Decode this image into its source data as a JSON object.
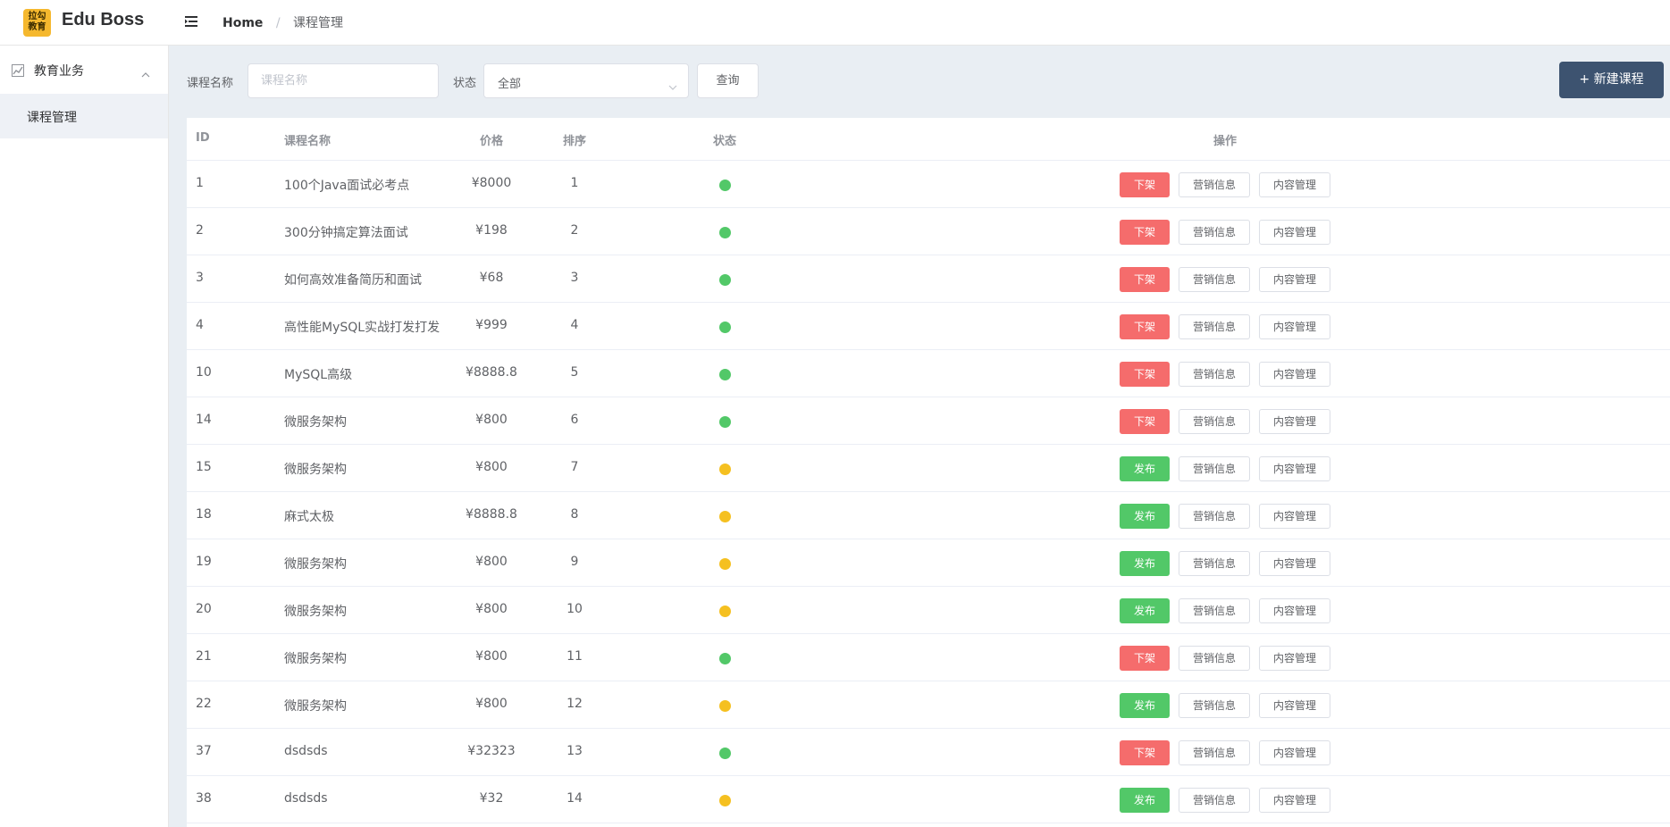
{
  "header": {
    "logo_text_top": "拉勾",
    "logo_text_bottom": "教育",
    "app_title": "Edu Boss",
    "breadcrumb_home": "Home",
    "breadcrumb_sep": "/",
    "breadcrumb_current": "课程管理"
  },
  "sidebar": {
    "group_label": "教育业务",
    "items": [
      {
        "label": "课程管理"
      }
    ]
  },
  "filters": {
    "name_label": "课程名称",
    "name_placeholder": "课程名称",
    "name_value": "",
    "status_label": "状态",
    "status_value": "全部",
    "query_label": "查询",
    "new_label": "+ 新建课程"
  },
  "table": {
    "headers": {
      "id": "ID",
      "name": "课程名称",
      "price": "价格",
      "sort": "排序",
      "status": "状态",
      "actions": "操作"
    },
    "status_colors": {
      "published": "#52c868",
      "unpublished": "#f5c020"
    },
    "action_colors": {
      "offline": "#f56c6c",
      "publish": "#52c868"
    },
    "marketing_label": "营销信息",
    "content_label": "内容管理",
    "rows": [
      {
        "id": "1",
        "name": "100个Java面试必考点",
        "price": "¥8000",
        "sort": "1",
        "status": "published",
        "action": "下架"
      },
      {
        "id": "2",
        "name": "300分钟搞定算法面试",
        "price": "¥198",
        "sort": "2",
        "status": "published",
        "action": "下架"
      },
      {
        "id": "3",
        "name": "如何高效准备简历和面试",
        "price": "¥68",
        "sort": "3",
        "status": "published",
        "action": "下架"
      },
      {
        "id": "4",
        "name": "高性能MySQL实战打发打发",
        "price": "¥999",
        "sort": "4",
        "status": "published",
        "action": "下架"
      },
      {
        "id": "10",
        "name": "MySQL高级",
        "price": "¥8888.8",
        "sort": "5",
        "status": "published",
        "action": "下架"
      },
      {
        "id": "14",
        "name": "微服务架构",
        "price": "¥800",
        "sort": "6",
        "status": "published",
        "action": "下架"
      },
      {
        "id": "15",
        "name": "微服务架构",
        "price": "¥800",
        "sort": "7",
        "status": "unpublished",
        "action": "发布"
      },
      {
        "id": "18",
        "name": "麻式太极",
        "price": "¥8888.8",
        "sort": "8",
        "status": "unpublished",
        "action": "发布"
      },
      {
        "id": "19",
        "name": "微服务架构",
        "price": "¥800",
        "sort": "9",
        "status": "unpublished",
        "action": "发布"
      },
      {
        "id": "20",
        "name": "微服务架构",
        "price": "¥800",
        "sort": "10",
        "status": "unpublished",
        "action": "发布"
      },
      {
        "id": "21",
        "name": "微服务架构",
        "price": "¥800",
        "sort": "11",
        "status": "published",
        "action": "下架"
      },
      {
        "id": "22",
        "name": "微服务架构",
        "price": "¥800",
        "sort": "12",
        "status": "unpublished",
        "action": "发布"
      },
      {
        "id": "37",
        "name": "dsdsds",
        "price": "¥32323",
        "sort": "13",
        "status": "published",
        "action": "下架"
      },
      {
        "id": "38",
        "name": "dsdsds",
        "price": "¥32",
        "sort": "14",
        "status": "unpublished",
        "action": "发布"
      }
    ]
  }
}
